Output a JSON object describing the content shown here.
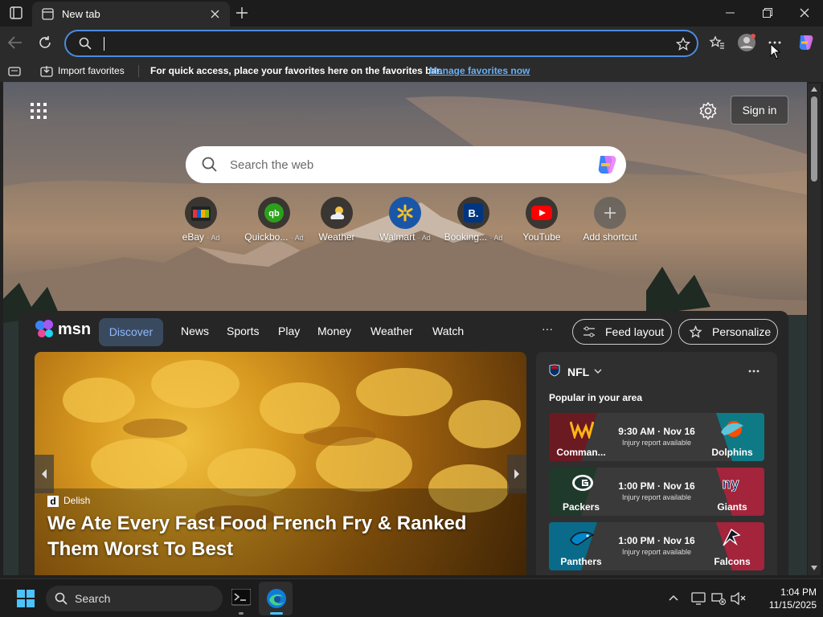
{
  "browser": {
    "tab_title": "New tab",
    "address_value": "",
    "fav_import": "Import favorites",
    "fav_hint": "For quick access, place your favorites here on the favorites bar.",
    "fav_manage": "Manage favorites now"
  },
  "newtab": {
    "search_placeholder": "Search the web",
    "signin": "Sign in",
    "shortcuts": [
      {
        "label": "eBay",
        "ad": "· Ad"
      },
      {
        "label": "Quickbo...",
        "ad": "· Ad"
      },
      {
        "label": "Weather",
        "ad": ""
      },
      {
        "label": "Walmart",
        "ad": "· Ad"
      },
      {
        "label": "Booking...",
        "ad": "· Ad"
      },
      {
        "label": "YouTube",
        "ad": ""
      },
      {
        "label": "Add shortcut",
        "ad": ""
      }
    ]
  },
  "msn": {
    "logo": "msn",
    "nav": [
      "Discover",
      "News",
      "Sports",
      "Play",
      "Money",
      "Weather",
      "Watch"
    ],
    "more": "···",
    "feed_layout": "Feed layout",
    "personalize": "Personalize",
    "hero": {
      "source": "Delish",
      "headline": "We Ate Every Fast Food French Fry & Ranked Them Worst To Best"
    },
    "nfl": {
      "title": "NFL",
      "subtitle": "Popular in your area",
      "games": [
        {
          "home": "Comman...",
          "away": "Dolphins",
          "time": "9:30 AM · Nov 16",
          "note": "Injury report available",
          "home_color": "#6b1a22",
          "away_color": "#0e7a86"
        },
        {
          "home": "Packers",
          "away": "Giants",
          "time": "1:00 PM · Nov 16",
          "note": "Injury report available",
          "home_color": "#1f3a2a",
          "away_color": "#a3243b"
        },
        {
          "home": "Panthers",
          "away": "Falcons",
          "time": "1:00 PM · Nov 16",
          "note": "Injury report available",
          "home_color": "#0a6a8a",
          "away_color": "#a3243b"
        }
      ]
    }
  },
  "taskbar": {
    "search": "Search",
    "time": "1:04 PM",
    "date": "11/15/2025"
  }
}
